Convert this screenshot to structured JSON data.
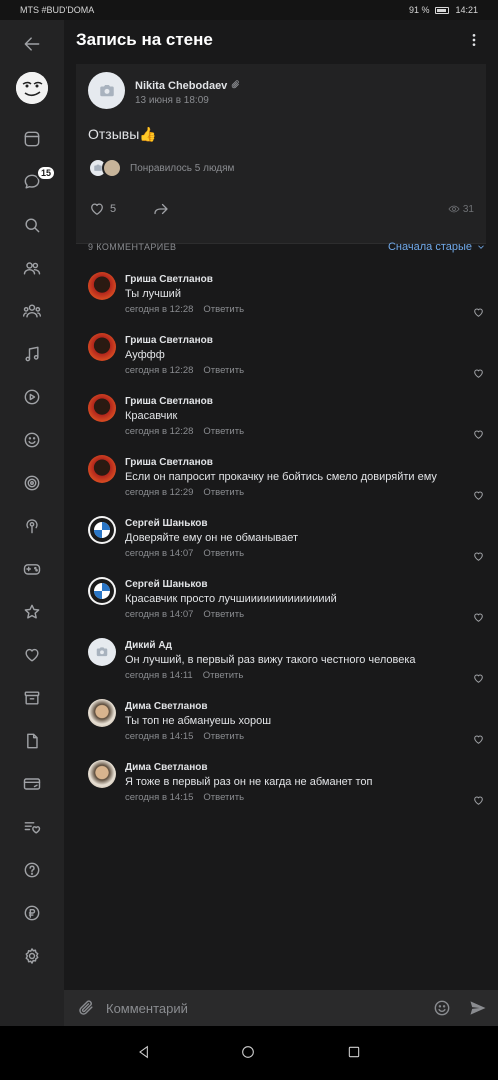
{
  "status_bar": {
    "carrier": "MTS #BUD'DOMA",
    "battery": "91 %",
    "time": "14:21"
  },
  "header": {
    "title": "Запись на стене"
  },
  "sidebar": {
    "messages_badge": "15"
  },
  "post": {
    "author": "Nikita Chebodaev",
    "date": "13 июня в 18:09",
    "text": "Отзывы👍",
    "likes_summary": "Понравилось 5 людям",
    "like_count": "5",
    "views": "31"
  },
  "comments_section": {
    "count_label": "9 КОММЕНТАРИЕВ",
    "sort_label": "Сначала старые",
    "reply_label": "Ответить",
    "items": [
      {
        "name": "Гриша Светланов",
        "text": "Ты лучший",
        "time": "сегодня в 12:28"
      },
      {
        "name": "Гриша Светланов",
        "text": "Ауффф",
        "time": "сегодня в 12:28"
      },
      {
        "name": "Гриша Светланов",
        "text": "Красавчик",
        "time": "сегодня в 12:28"
      },
      {
        "name": "Гриша Светланов",
        "text": "Если он папросит прокачку не бойтись смело довиряйти ему",
        "time": "сегодня в 12:29"
      },
      {
        "name": "Сергей Шаньков",
        "text": "Доверяйте ему он не обманывает",
        "time": "сегодня в 14:07"
      },
      {
        "name": "Сергей Шаньков",
        "text": "Красавчик просто лучшиииииииииииииий",
        "time": "сегодня в 14:07"
      },
      {
        "name": "Дикий Ад",
        "text": "Он лучший, в первый раз вижу такого честного человека",
        "time": "сегодня в 14:11"
      },
      {
        "name": "Дима Светланов",
        "text": "Ты топ не абмануешь хорош",
        "time": "сегодня в 14:15"
      },
      {
        "name": "Дима Светланов",
        "text": "Я тоже в первый раз он не кагда не абманет топ",
        "time": "сегодня в 14:15"
      }
    ]
  },
  "composer": {
    "placeholder": "Комментарий"
  }
}
